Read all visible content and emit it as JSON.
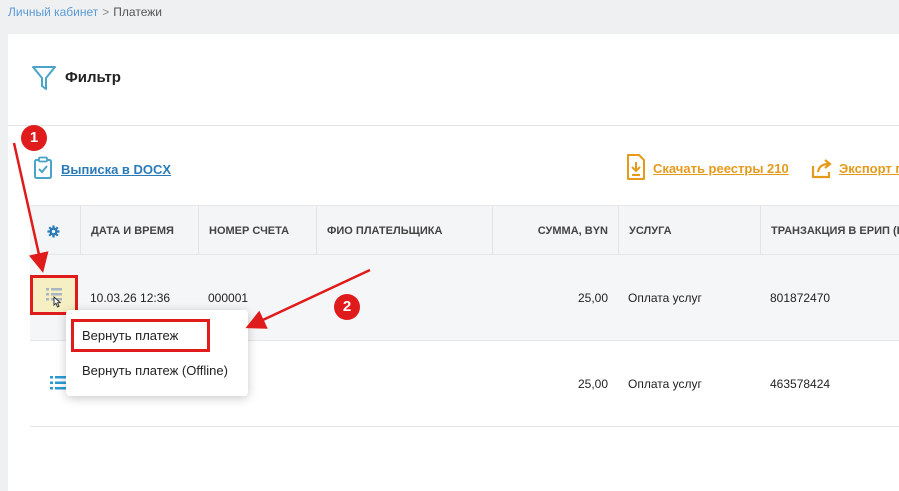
{
  "breadcrumb": {
    "home": "Личный кабинет",
    "separator": ">",
    "current": "Платежи"
  },
  "filter": {
    "label": "Фильтр",
    "icon": "filter-icon"
  },
  "actions": {
    "docx": "Выписка в DOCX",
    "registries": "Скачать реестры 210",
    "export": "Экспорт п"
  },
  "table": {
    "columns": {
      "settings_icon": "gear-icon",
      "datetime": "ДАТА И ВРЕМЯ",
      "account": "НОМЕР СЧЕТА",
      "payer": "ФИО ПЛАТЕЛЬЩИКА",
      "amount": "СУММА, BYN",
      "service": "УСЛУГА",
      "transaction": "ТРАНЗАКЦИЯ В ЕРИП (Е-"
    },
    "rows": [
      {
        "datetime": "10.03.26 12:36",
        "account": "000001",
        "payer": "",
        "amount": "25,00",
        "service": "Оплата услуг",
        "transaction": "801872470"
      },
      {
        "datetime": "",
        "account": "",
        "payer": "",
        "amount": "25,00",
        "service": "Оплата услуг",
        "transaction": "463578424"
      }
    ]
  },
  "row_menu": {
    "items": [
      "Вернуть платеж",
      "Вернуть платеж (Offline)"
    ]
  },
  "annotations": {
    "step1": "1",
    "step2": "2"
  },
  "colors": {
    "accent_blue": "#2b7bb9",
    "accent_orange": "#e59a1b",
    "highlight_red": "#e01b1b",
    "icon_teal": "#4aa3c9"
  }
}
